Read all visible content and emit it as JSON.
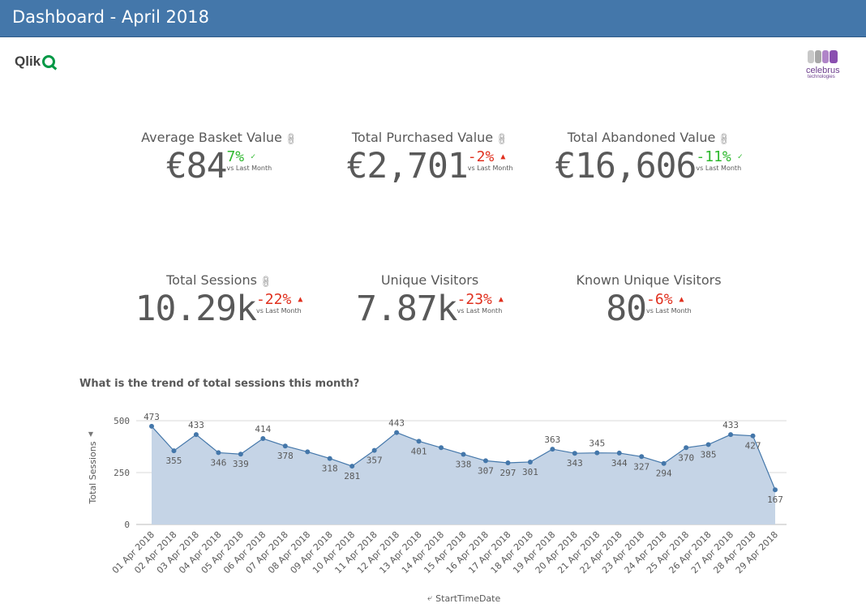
{
  "header": {
    "title": "Dashboard - April 2018"
  },
  "logos": {
    "qlik": {
      "text": "Qlik",
      "color": "#009845"
    },
    "celebrus": {
      "name": "celebrus",
      "sub": "technologies",
      "color": "#6b3d8c"
    }
  },
  "colors": {
    "header_bg": "#4477aa",
    "good": "#2eb82e",
    "bad": "#e0301e",
    "area_fill": "#c5d4e6",
    "line": "#4477aa"
  },
  "kpis": [
    {
      "label": "Average Basket Value",
      "value": "€84",
      "delta": "7%",
      "trend": "good",
      "indicator": "✓",
      "sub": "vs Last Month",
      "linked": true
    },
    {
      "label": "Total Purchased Value",
      "value": "€2,701",
      "delta": "-2%",
      "trend": "bad",
      "indicator": "▲",
      "sub": "vs Last Month",
      "linked": true
    },
    {
      "label": "Total Abandoned Value",
      "value": "€16,606",
      "delta": "-11%",
      "trend": "good",
      "indicator": "✓",
      "sub": "vs Last Month",
      "linked": true
    },
    {
      "label": "Total Sessions",
      "value": "10.29k",
      "delta": "-22%",
      "trend": "bad",
      "indicator": "▲",
      "sub": "vs Last Month",
      "linked": true
    },
    {
      "label": "Unique Visitors",
      "value": "7.87k",
      "delta": "-23%",
      "trend": "bad",
      "indicator": "▲",
      "sub": "vs Last Month",
      "linked": false
    },
    {
      "label": "Known Unique Visitors",
      "value": "80",
      "delta": "-6%",
      "trend": "bad",
      "indicator": "▲",
      "sub": "vs Last Month",
      "linked": false
    }
  ],
  "chart_title": "What is the trend of total sessions this month?",
  "chart_data": {
    "type": "area",
    "title": "What is the trend of total sessions this month?",
    "xlabel": "StartTimeDate",
    "ylabel": "Total Sessions",
    "ylim": [
      0,
      500
    ],
    "yticks": [
      0,
      250,
      500
    ],
    "grid": true,
    "categories": [
      "01 Apr 2018",
      "02 Apr 2018",
      "03 Apr 2018",
      "04 Apr 2018",
      "05 Apr 2018",
      "06 Apr 2018",
      "07 Apr 2018",
      "08 Apr 2018",
      "09 Apr 2018",
      "10 Apr 2018",
      "11 Apr 2018",
      "12 Apr 2018",
      "13 Apr 2018",
      "14 Apr 2018",
      "15 Apr 2018",
      "16 Apr 2018",
      "17 Apr 2018",
      "18 Apr 2018",
      "19 Apr 2018",
      "20 Apr 2018",
      "21 Apr 2018",
      "22 Apr 2018",
      "23 Apr 2018",
      "24 Apr 2018",
      "25 Apr 2018",
      "26 Apr 2018",
      "27 Apr 2018",
      "28 Apr 2018",
      "29 Apr 2018"
    ],
    "values": [
      473,
      355,
      433,
      346,
      339,
      414,
      378,
      350,
      318,
      281,
      357,
      443,
      401,
      370,
      338,
      307,
      297,
      301,
      363,
      343,
      345,
      344,
      327,
      294,
      370,
      385,
      433,
      427,
      167
    ],
    "data_labels": [
      "473",
      "355",
      "433",
      "346",
      "339",
      "414",
      "378",
      "",
      "318",
      "281",
      "357",
      "443",
      "401",
      "",
      "338",
      "307",
      "297",
      "301",
      "363",
      "343",
      "345",
      "344",
      "327",
      "294",
      "370",
      "385",
      "433",
      "427",
      "167"
    ]
  }
}
